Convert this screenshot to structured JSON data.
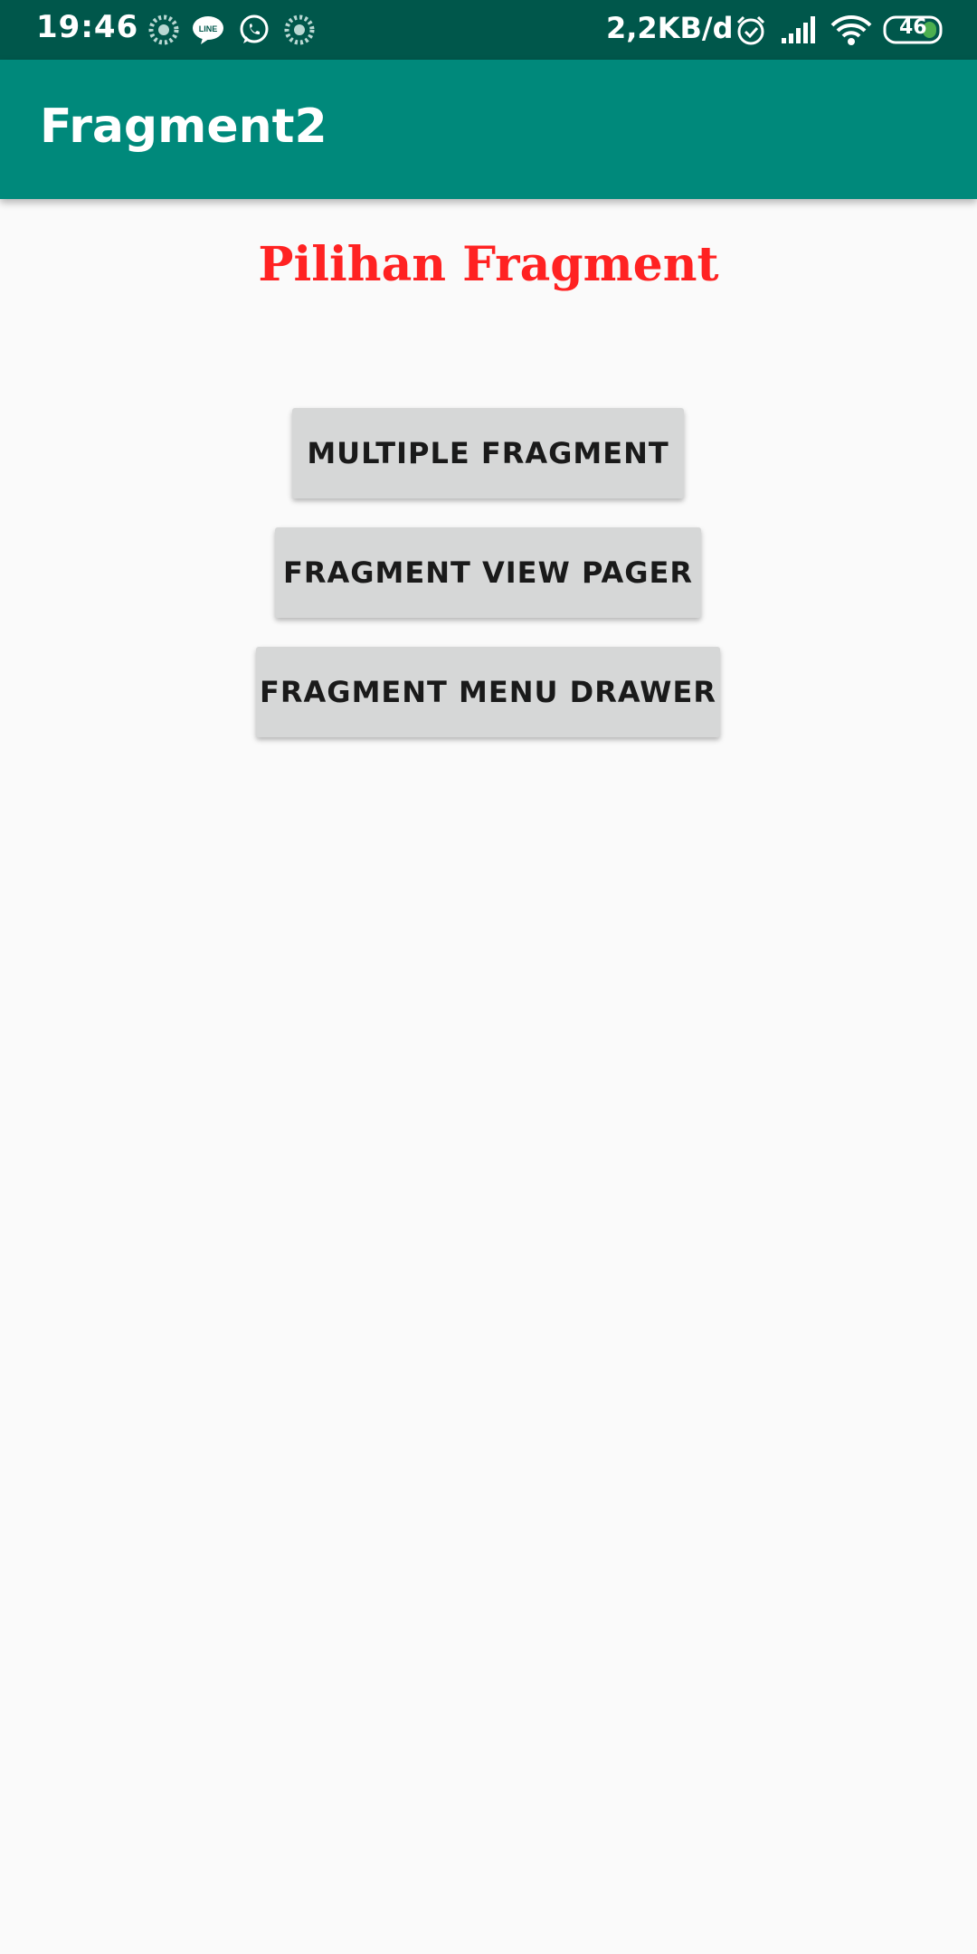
{
  "status_bar": {
    "time": "19:46",
    "network_speed": "2,2KB/d",
    "battery_level": "46",
    "icons_left": [
      "loading-icon",
      "line-icon",
      "whatsapp-icon",
      "loading-icon"
    ],
    "icons_right": [
      "alarm-icon",
      "signal-icon",
      "wifi-icon",
      "battery-icon"
    ],
    "background_color": "#00574b"
  },
  "app_bar": {
    "title": "Fragment2",
    "background_color": "#00897b"
  },
  "main": {
    "heading": "Pilihan Fragment",
    "heading_color": "#ff2222",
    "buttons": [
      {
        "label": "MULTIPLE FRAGMENT"
      },
      {
        "label": "FRAGMENT VIEW PAGER"
      },
      {
        "label": "FRAGMENT MENU DRAWER"
      }
    ]
  }
}
